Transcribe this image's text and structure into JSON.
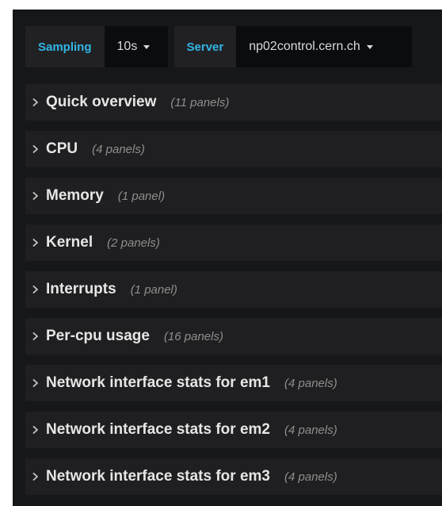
{
  "variables": {
    "sampling": {
      "label": "Sampling",
      "value": "10s"
    },
    "server": {
      "label": "Server",
      "value": "np02control.cern.ch"
    }
  },
  "rows": [
    {
      "title": "Quick overview",
      "count": "(11 panels)"
    },
    {
      "title": "CPU",
      "count": "(4 panels)"
    },
    {
      "title": "Memory",
      "count": "(1 panel)"
    },
    {
      "title": "Kernel",
      "count": "(2 panels)"
    },
    {
      "title": "Interrupts",
      "count": "(1 panel)"
    },
    {
      "title": "Per-cpu usage",
      "count": "(16 panels)"
    },
    {
      "title": "Network interface stats for em1",
      "count": "(4 panels)"
    },
    {
      "title": "Network interface stats for em2",
      "count": "(4 panels)"
    },
    {
      "title": "Network interface stats for em3",
      "count": "(4 panels)"
    }
  ],
  "icons": {
    "row_toggle": "chevron-right-icon",
    "dropdown": "caret-down-icon"
  },
  "colors": {
    "background": "#161719",
    "row_background": "#1f1f21",
    "variable_label": "#33b5e5"
  }
}
